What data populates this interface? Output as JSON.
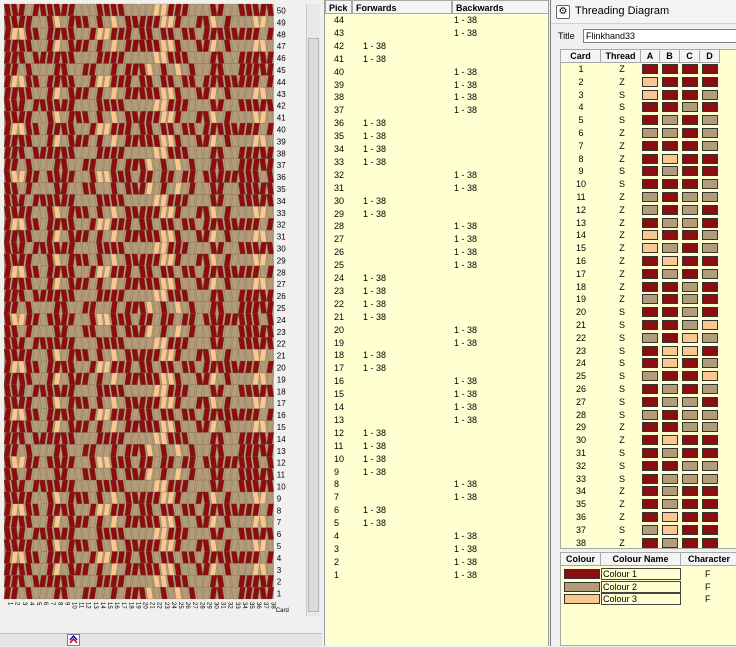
{
  "pattern": {
    "colors": {
      "c1": "#8b0d10",
      "c2": "#b39c7a",
      "c3": "#f8c890"
    },
    "card_count": 38,
    "pick_count": 50,
    "pick_numbers_right": [
      50,
      49,
      48,
      47,
      46,
      45,
      44,
      43,
      42,
      41,
      40,
      39,
      38,
      37,
      36,
      35,
      34,
      33,
      32,
      31,
      30,
      29,
      28,
      27,
      26,
      25,
      24,
      23,
      22,
      21,
      20,
      19,
      18,
      17,
      16,
      15,
      14,
      13,
      12,
      11,
      10,
      9,
      8,
      7,
      6,
      5,
      4,
      3,
      2,
      1
    ],
    "card_axis_label": "Card"
  },
  "pick_list": {
    "headers": {
      "pick": "Pick",
      "forwards": "Forwards",
      "backwards": "Backwards"
    },
    "rows": [
      {
        "pick": "44",
        "forwards": "",
        "backwards": "1 - 38"
      },
      {
        "pick": "43",
        "forwards": "",
        "backwards": "1 - 38"
      },
      {
        "pick": "42",
        "forwards": "1 - 38",
        "backwards": ""
      },
      {
        "pick": "41",
        "forwards": "1 - 38",
        "backwards": ""
      },
      {
        "pick": "40",
        "forwards": "",
        "backwards": "1 - 38"
      },
      {
        "pick": "39",
        "forwards": "",
        "backwards": "1 - 38"
      },
      {
        "pick": "38",
        "forwards": "",
        "backwards": "1 - 38"
      },
      {
        "pick": "37",
        "forwards": "",
        "backwards": "1 - 38"
      },
      {
        "pick": "36",
        "forwards": "1 - 38",
        "backwards": ""
      },
      {
        "pick": "35",
        "forwards": "1 - 38",
        "backwards": ""
      },
      {
        "pick": "34",
        "forwards": "1 - 38",
        "backwards": ""
      },
      {
        "pick": "33",
        "forwards": "1 - 38",
        "backwards": ""
      },
      {
        "pick": "32",
        "forwards": "",
        "backwards": "1 - 38"
      },
      {
        "pick": "31",
        "forwards": "",
        "backwards": "1 - 38"
      },
      {
        "pick": "30",
        "forwards": "1 - 38",
        "backwards": ""
      },
      {
        "pick": "29",
        "forwards": "1 - 38",
        "backwards": ""
      },
      {
        "pick": "28",
        "forwards": "",
        "backwards": "1 - 38"
      },
      {
        "pick": "27",
        "forwards": "",
        "backwards": "1 - 38"
      },
      {
        "pick": "26",
        "forwards": "",
        "backwards": "1 - 38"
      },
      {
        "pick": "25",
        "forwards": "",
        "backwards": "1 - 38"
      },
      {
        "pick": "24",
        "forwards": "1 - 38",
        "backwards": ""
      },
      {
        "pick": "23",
        "forwards": "1 - 38",
        "backwards": ""
      },
      {
        "pick": "22",
        "forwards": "1 - 38",
        "backwards": ""
      },
      {
        "pick": "21",
        "forwards": "1 - 38",
        "backwards": ""
      },
      {
        "pick": "20",
        "forwards": "",
        "backwards": "1 - 38"
      },
      {
        "pick": "19",
        "forwards": "",
        "backwards": "1 - 38"
      },
      {
        "pick": "18",
        "forwards": "1 - 38",
        "backwards": ""
      },
      {
        "pick": "17",
        "forwards": "1 - 38",
        "backwards": ""
      },
      {
        "pick": "16",
        "forwards": "",
        "backwards": "1 - 38"
      },
      {
        "pick": "15",
        "forwards": "",
        "backwards": "1 - 38"
      },
      {
        "pick": "14",
        "forwards": "",
        "backwards": "1 - 38"
      },
      {
        "pick": "13",
        "forwards": "",
        "backwards": "1 - 38"
      },
      {
        "pick": "12",
        "forwards": "1 - 38",
        "backwards": ""
      },
      {
        "pick": "11",
        "forwards": "1 - 38",
        "backwards": ""
      },
      {
        "pick": "10",
        "forwards": "1 - 38",
        "backwards": ""
      },
      {
        "pick": "9",
        "forwards": "1 - 38",
        "backwards": ""
      },
      {
        "pick": "8",
        "forwards": "",
        "backwards": "1 - 38"
      },
      {
        "pick": "7",
        "forwards": "",
        "backwards": "1 - 38"
      },
      {
        "pick": "6",
        "forwards": "1 - 38",
        "backwards": ""
      },
      {
        "pick": "5",
        "forwards": "1 - 38",
        "backwards": ""
      },
      {
        "pick": "4",
        "forwards": "",
        "backwards": "1 - 38"
      },
      {
        "pick": "3",
        "forwards": "",
        "backwards": "1 - 38"
      },
      {
        "pick": "2",
        "forwards": "",
        "backwards": "1 - 38"
      },
      {
        "pick": "1",
        "forwards": "",
        "backwards": "1 - 38"
      }
    ]
  },
  "threading": {
    "window_title": "Threading Diagram",
    "title_label": "Title",
    "title_value": "Flinkhand33",
    "headers": {
      "card": "Card",
      "thread": "Thread",
      "a": "A",
      "b": "B",
      "c": "C",
      "d": "D"
    },
    "cards": [
      {
        "card": "1",
        "dir": "Z",
        "holes": [
          1,
          1,
          1,
          1
        ]
      },
      {
        "card": "2",
        "dir": "Z",
        "holes": [
          3,
          1,
          1,
          1
        ]
      },
      {
        "card": "3",
        "dir": "S",
        "holes": [
          3,
          1,
          1,
          2
        ]
      },
      {
        "card": "4",
        "dir": "S",
        "holes": [
          1,
          1,
          2,
          1
        ]
      },
      {
        "card": "5",
        "dir": "S",
        "holes": [
          1,
          2,
          1,
          2
        ]
      },
      {
        "card": "6",
        "dir": "Z",
        "holes": [
          2,
          2,
          1,
          2
        ]
      },
      {
        "card": "7",
        "dir": "Z",
        "holes": [
          1,
          1,
          1,
          2
        ]
      },
      {
        "card": "8",
        "dir": "Z",
        "holes": [
          1,
          3,
          1,
          1
        ]
      },
      {
        "card": "9",
        "dir": "S",
        "holes": [
          1,
          2,
          1,
          1
        ]
      },
      {
        "card": "10",
        "dir": "S",
        "holes": [
          1,
          1,
          1,
          2
        ]
      },
      {
        "card": "11",
        "dir": "Z",
        "holes": [
          2,
          1,
          2,
          2
        ]
      },
      {
        "card": "12",
        "dir": "Z",
        "holes": [
          2,
          1,
          2,
          1
        ]
      },
      {
        "card": "13",
        "dir": "Z",
        "holes": [
          1,
          2,
          2,
          1
        ]
      },
      {
        "card": "14",
        "dir": "Z",
        "holes": [
          3,
          1,
          1,
          2
        ]
      },
      {
        "card": "15",
        "dir": "Z",
        "holes": [
          3,
          2,
          1,
          2
        ]
      },
      {
        "card": "16",
        "dir": "Z",
        "holes": [
          1,
          3,
          1,
          1
        ]
      },
      {
        "card": "17",
        "dir": "Z",
        "holes": [
          1,
          2,
          1,
          2
        ]
      },
      {
        "card": "18",
        "dir": "Z",
        "holes": [
          1,
          1,
          2,
          1
        ]
      },
      {
        "card": "19",
        "dir": "Z",
        "holes": [
          2,
          1,
          2,
          1
        ]
      },
      {
        "card": "20",
        "dir": "S",
        "holes": [
          1,
          1,
          2,
          1
        ]
      },
      {
        "card": "21",
        "dir": "S",
        "holes": [
          1,
          1,
          2,
          3
        ]
      },
      {
        "card": "22",
        "dir": "S",
        "holes": [
          2,
          1,
          3,
          2
        ]
      },
      {
        "card": "23",
        "dir": "S",
        "holes": [
          1,
          3,
          3,
          1
        ]
      },
      {
        "card": "24",
        "dir": "S",
        "holes": [
          1,
          3,
          1,
          2
        ]
      },
      {
        "card": "25",
        "dir": "S",
        "holes": [
          2,
          1,
          1,
          3
        ]
      },
      {
        "card": "26",
        "dir": "S",
        "holes": [
          1,
          2,
          1,
          2
        ]
      },
      {
        "card": "27",
        "dir": "S",
        "holes": [
          1,
          2,
          2,
          1
        ]
      },
      {
        "card": "28",
        "dir": "S",
        "holes": [
          2,
          1,
          2,
          2
        ]
      },
      {
        "card": "29",
        "dir": "Z",
        "holes": [
          1,
          1,
          2,
          2
        ]
      },
      {
        "card": "30",
        "dir": "Z",
        "holes": [
          1,
          3,
          1,
          1
        ]
      },
      {
        "card": "31",
        "dir": "S",
        "holes": [
          1,
          2,
          1,
          1
        ]
      },
      {
        "card": "32",
        "dir": "S",
        "holes": [
          1,
          1,
          2,
          2
        ]
      },
      {
        "card": "33",
        "dir": "S",
        "holes": [
          1,
          2,
          2,
          2
        ]
      },
      {
        "card": "34",
        "dir": "Z",
        "holes": [
          1,
          2,
          1,
          1
        ]
      },
      {
        "card": "35",
        "dir": "Z",
        "holes": [
          1,
          2,
          1,
          1
        ]
      },
      {
        "card": "36",
        "dir": "Z",
        "holes": [
          1,
          3,
          1,
          1
        ]
      },
      {
        "card": "37",
        "dir": "S",
        "holes": [
          2,
          3,
          1,
          1
        ]
      },
      {
        "card": "38",
        "dir": "Z",
        "holes": [
          1,
          2,
          1,
          1
        ]
      }
    ]
  },
  "colours": {
    "headers": {
      "colour": "Colour",
      "name": "Colour Name",
      "character": "Character"
    },
    "rows": [
      {
        "swatch": "#8b0d10",
        "name": "Colour 1",
        "character": "F"
      },
      {
        "swatch": "#b39c7a",
        "name": "Colour 2",
        "character": "F"
      },
      {
        "swatch": "#f8c890",
        "name": "Colour 3",
        "character": "F"
      }
    ]
  }
}
